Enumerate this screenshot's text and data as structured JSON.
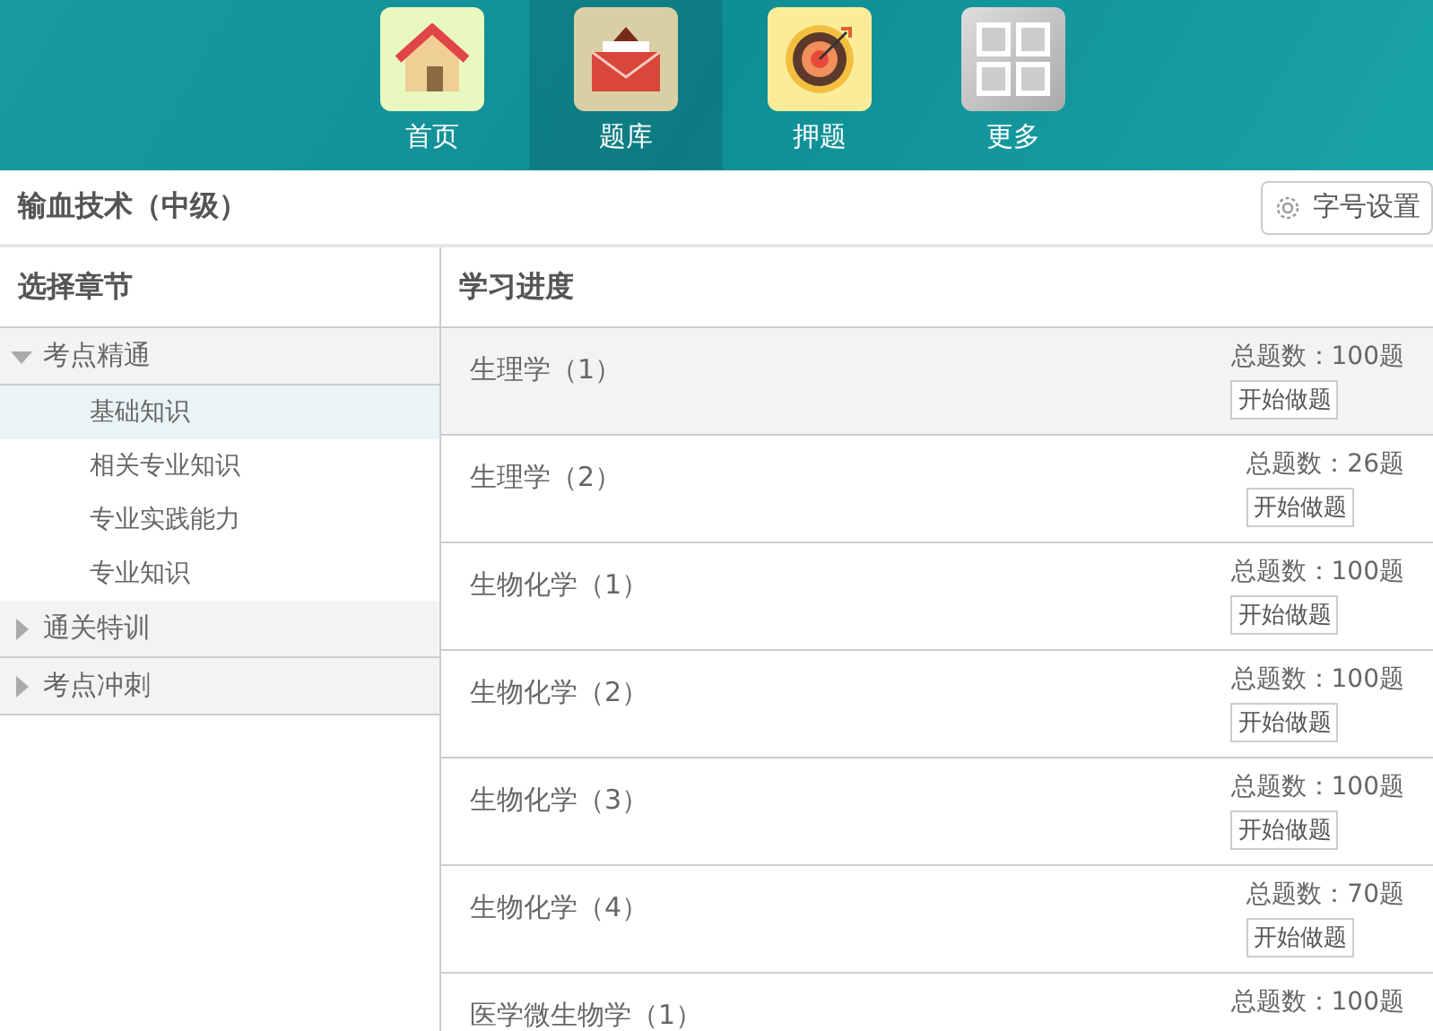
{
  "nav": [
    {
      "label": "首页",
      "kind": "home",
      "selected": false
    },
    {
      "label": "题库",
      "kind": "bank",
      "selected": true
    },
    {
      "label": "押题",
      "kind": "target",
      "selected": false
    },
    {
      "label": "更多",
      "kind": "more",
      "selected": false
    }
  ],
  "title": "输血技术（中级）",
  "font_button": "字号设置",
  "sidebar": {
    "heading": "选择章节",
    "groups": [
      {
        "label": "考点精通",
        "expanded": true,
        "children": [
          {
            "label": "基础知识",
            "selected": true
          },
          {
            "label": "相关专业知识",
            "selected": false
          },
          {
            "label": "专业实践能力",
            "selected": false
          },
          {
            "label": "专业知识",
            "selected": false
          }
        ]
      },
      {
        "label": "通关特训",
        "expanded": false
      },
      {
        "label": "考点冲刺",
        "expanded": false
      }
    ]
  },
  "progress": {
    "heading": "学习进度",
    "rows": [
      {
        "name": "生理学（1）",
        "total": "总题数：100题",
        "button": "开始做题",
        "selected": true
      },
      {
        "name": "生理学（2）",
        "total": "总题数：26题",
        "button": "开始做题",
        "selected": false
      },
      {
        "name": "生物化学（1）",
        "total": "总题数：100题",
        "button": "开始做题",
        "selected": false
      },
      {
        "name": "生物化学（2）",
        "total": "总题数：100题",
        "button": "开始做题",
        "selected": false
      },
      {
        "name": "生物化学（3）",
        "total": "总题数：100题",
        "button": "开始做题",
        "selected": false
      },
      {
        "name": "生物化学（4）",
        "total": "总题数：70题",
        "button": "开始做题",
        "selected": false
      },
      {
        "name": "医学微生物学（1）",
        "total": "总题数：100题",
        "selected": false
      }
    ]
  }
}
